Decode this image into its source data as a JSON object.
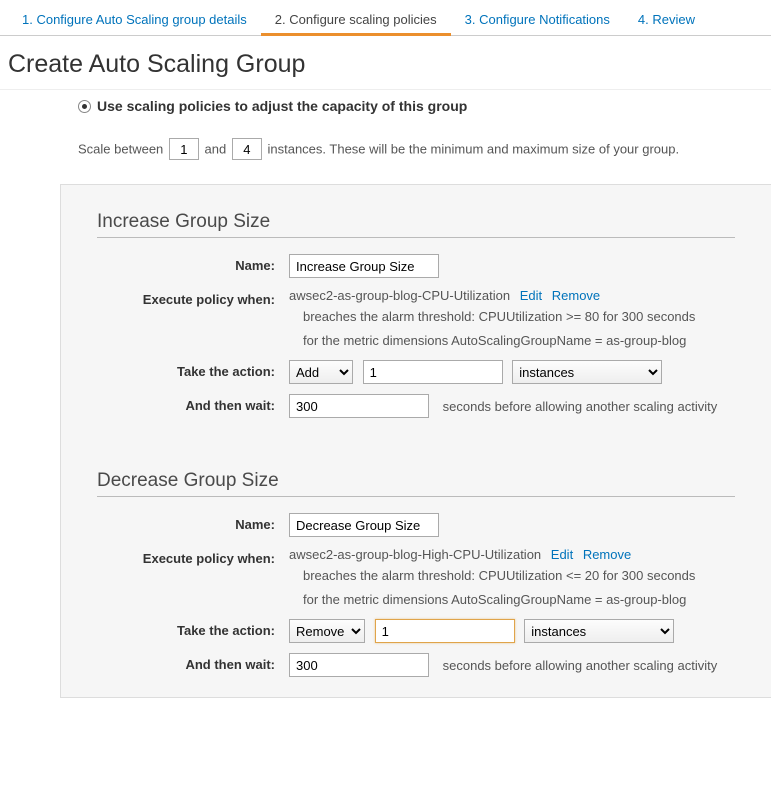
{
  "tabs": {
    "items": [
      {
        "label": "1. Configure Auto Scaling group details"
      },
      {
        "label": "2. Configure scaling policies"
      },
      {
        "label": "3. Configure Notifications"
      },
      {
        "label": "4. Review"
      }
    ]
  },
  "page": {
    "title": "Create Auto Scaling Group"
  },
  "radio": {
    "label": "Use scaling policies to adjust the capacity of this group"
  },
  "scale": {
    "prefix": "Scale between",
    "min": "1",
    "and": "and",
    "max": "4",
    "suffix": "instances. These will be the minimum and maximum size of your group."
  },
  "labels": {
    "name": "Name:",
    "execute": "Execute policy when:",
    "action": "Take the action:",
    "wait": "And then wait:",
    "edit": "Edit",
    "remove": "Remove"
  },
  "increase": {
    "title": "Increase Group Size",
    "name": "Increase Group Size",
    "alarm": "awsec2-as-group-blog-CPU-Utilization",
    "desc1": "breaches the alarm threshold: CPUUtilization >= 80 for 300 seconds",
    "desc2": "for the metric dimensions AutoScalingGroupName = as-group-blog",
    "op": "Add",
    "amount": "1",
    "unit": "instances",
    "cooldown": "300",
    "cooldown_text": "seconds before allowing another scaling activity"
  },
  "decrease": {
    "title": "Decrease Group Size",
    "name": "Decrease Group Size",
    "alarm": "awsec2-as-group-blog-High-CPU-Utilization",
    "desc1": "breaches the alarm threshold: CPUUtilization <= 20 for 300 seconds",
    "desc2": "for the metric dimensions AutoScalingGroupName = as-group-blog",
    "op": "Remove",
    "amount": "1",
    "unit": "instances",
    "cooldown": "300",
    "cooldown_text": "seconds before allowing another scaling activity"
  }
}
